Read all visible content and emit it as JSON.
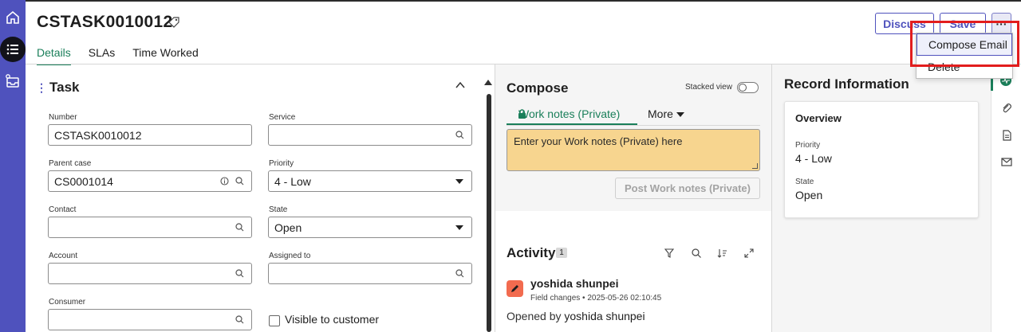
{
  "record": {
    "number": "CSTASK0010012"
  },
  "tabs": [
    {
      "label": "Details"
    },
    {
      "label": "SLAs"
    },
    {
      "label": "Time Worked"
    }
  ],
  "header_buttons": {
    "discuss": "Discuss",
    "save": "Save",
    "more": "···"
  },
  "menu": {
    "items": [
      {
        "label": "Compose Email"
      },
      {
        "label": "Delete"
      }
    ]
  },
  "task": {
    "title": "Task",
    "fields": {
      "number": {
        "label": "Number",
        "value": "CSTASK0010012"
      },
      "service": {
        "label": "Service",
        "value": ""
      },
      "parent_case": {
        "label": "Parent case",
        "value": "CS0001014"
      },
      "priority": {
        "label": "Priority",
        "value": "4 - Low"
      },
      "contact": {
        "label": "Contact",
        "value": ""
      },
      "state": {
        "label": "State",
        "value": "Open"
      },
      "account": {
        "label": "Account",
        "value": ""
      },
      "assigned_to": {
        "label": "Assigned to",
        "value": ""
      },
      "consumer": {
        "label": "Consumer",
        "value": ""
      }
    },
    "visible_to_customer": "Visible to customer"
  },
  "compose": {
    "title": "Compose",
    "stacked_view": "Stacked view",
    "tab_work_notes": "Work notes (Private)",
    "more": "More",
    "placeholder": "Enter your Work notes (Private) here",
    "post_button": "Post Work notes (Private)"
  },
  "activity": {
    "title": "Activity",
    "count": "1",
    "entry": {
      "user": "yoshida shunpei",
      "meta": "Field changes • 2025-05-26 02:10:45",
      "opened_by_label": "Opened by",
      "opened_by_value": "yoshida shunpei"
    }
  },
  "record_info": {
    "title": "Record Information",
    "overview": "Overview",
    "priority_label": "Priority",
    "priority_value": "4 - Low",
    "state_label": "State",
    "state_value": "Open"
  },
  "colors": {
    "rail": "#4f52bd",
    "accent_green": "#1a7f5a",
    "notes_bg": "#f7d58f",
    "highlight": "#e21d1d"
  }
}
